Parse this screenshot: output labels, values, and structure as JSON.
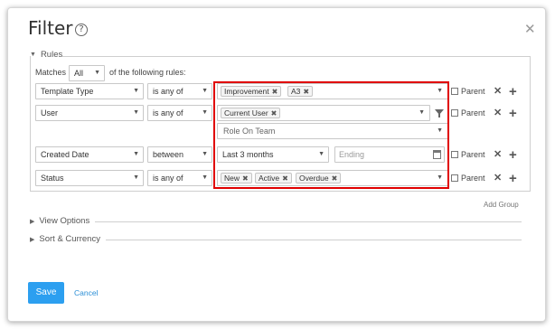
{
  "dialog": {
    "title": "Filter",
    "help_glyph": "?",
    "close_glyph": "✕"
  },
  "rules": {
    "legend": "Rules",
    "matches_label": "Matches",
    "matches_value": "All",
    "matches_suffix": "of the following rules:",
    "rows": [
      {
        "field": "Template Type",
        "operator": "is any of",
        "tags": [
          "Improvement",
          "A3"
        ],
        "parent_label": "Parent"
      },
      {
        "field": "User",
        "operator": "is any of",
        "tags": [
          "Current User"
        ],
        "sub_placeholder": "Role On Team",
        "parent_label": "Parent"
      },
      {
        "field": "Created Date",
        "operator": "between",
        "value": "Last 3 months",
        "ending_placeholder": "Ending",
        "parent_label": "Parent"
      },
      {
        "field": "Status",
        "operator": "is any of",
        "tags": [
          "New",
          "Active",
          "Overdue"
        ],
        "parent_label": "Parent"
      }
    ],
    "add_group": "Add Group"
  },
  "sections": {
    "view_options": "View Options",
    "sort_currency": "Sort & Currency"
  },
  "buttons": {
    "save": "Save",
    "cancel": "Cancel"
  },
  "colors": {
    "primary": "#2c9ff0",
    "highlight": "#e00000"
  }
}
